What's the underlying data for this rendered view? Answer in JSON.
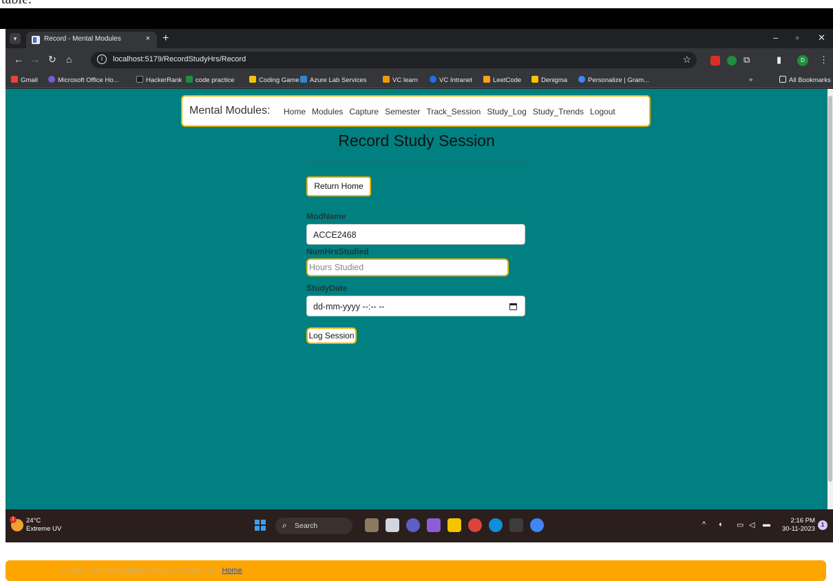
{
  "caption": "table.",
  "browser": {
    "tab_title": "Record - Mental Modules",
    "tab_close": "×",
    "new_tab": "+",
    "url": "localhost:5179/RecordStudyHrs/Record",
    "profile_initial": "D",
    "bookmarks": [
      "Gmail",
      "Microsoft Office Ho...",
      "HackerRank",
      "code practice",
      "Coding Game",
      "Azure Lab Services",
      "VC learn",
      "VC Intranet",
      "LeetCode",
      "Denigma",
      "Personalize | Gram..."
    ],
    "all_bookmarks": "All Bookmarks",
    "bookmarks_overflow": "»",
    "colors": {
      "frame": "#202124",
      "toolbar": "#35363a"
    }
  },
  "page": {
    "background": "#008080",
    "accent": "#f0b400",
    "nav": {
      "brand": "Mental Modules:",
      "links": [
        "Home",
        "Modules",
        "Capture",
        "Semester",
        "Track_Session",
        "Study_Log",
        "Study_Trends",
        "Logout"
      ]
    },
    "title": "Record Study Session",
    "return_home": "Return Home",
    "fields": {
      "modname_label": "ModName",
      "modname_value": "ACCE2468",
      "hours_label": "NumHrsStudied",
      "hours_placeholder": "Hours Studied",
      "date_label": "StudyDate",
      "date_value": "dd-mm-yyyy --:-- --"
    },
    "log_button": "Log Session",
    "footer": {
      "text": "© 2023 - MentalModules3_POE_ST10186731 - ",
      "link": "Home"
    }
  },
  "taskbar": {
    "temperature": "24°C",
    "weather": "Extreme UV",
    "search": "Search",
    "time": "2:16 PM",
    "date": "30-11-2023",
    "notification_count": "1"
  }
}
